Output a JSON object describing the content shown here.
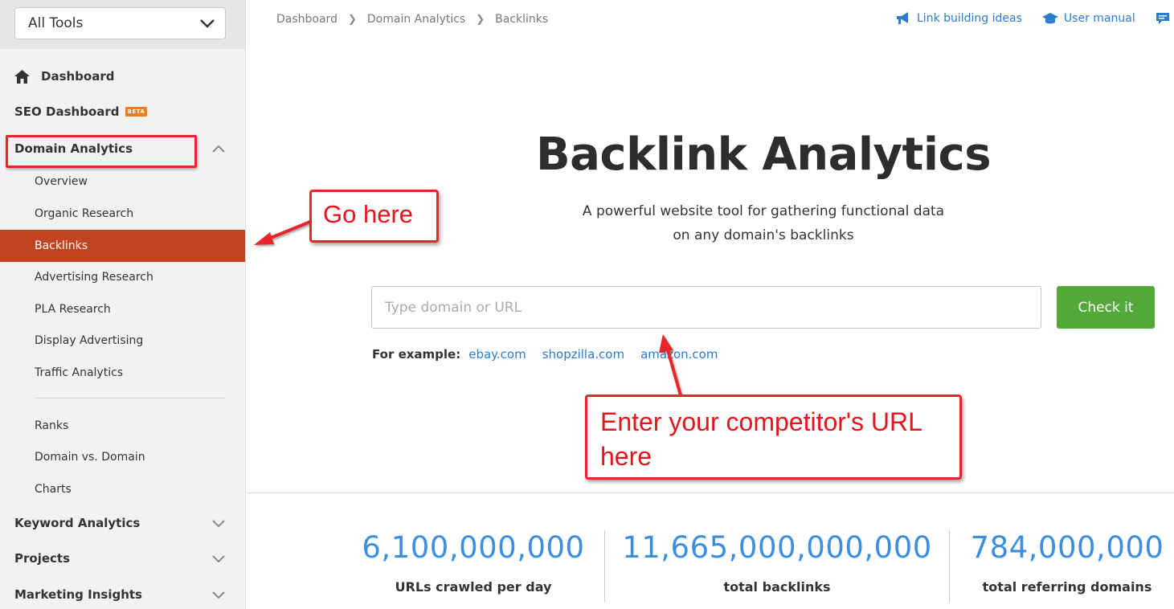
{
  "sidebar": {
    "tools_select": "All Tools",
    "dashboard": "Dashboard",
    "seo_dashboard": "SEO Dashboard",
    "beta_badge": "BETA",
    "domain_analytics": "Domain Analytics",
    "sub_items": [
      "Overview",
      "Organic Research",
      "Backlinks",
      "Advertising Research",
      "PLA Research",
      "Display Advertising",
      "Traffic Analytics",
      "Ranks",
      "Domain vs. Domain",
      "Charts"
    ],
    "keyword_analytics": "Keyword Analytics",
    "projects": "Projects",
    "marketing_insights": "Marketing Insights"
  },
  "breadcrumb": [
    "Dashboard",
    "Domain Analytics",
    "Backlinks"
  ],
  "header_links": {
    "link_building": "Link building ideas",
    "user_manual": "User manual",
    "truncated": "S"
  },
  "main": {
    "title": "Backlink Analytics",
    "subtitle_line1": "A powerful website tool for gathering functional data",
    "subtitle_line2": "on any domain's backlinks",
    "search_placeholder": "Type domain or URL",
    "check_button": "Check it",
    "examples_label": "For example:",
    "examples": [
      "ebay.com",
      "shopzilla.com",
      "amazon.com"
    ]
  },
  "stats": [
    {
      "value": "6,100,000,000",
      "label": "URLs crawled per day"
    },
    {
      "value": "11,665,000,000,000",
      "label": "total backlinks"
    },
    {
      "value": "784,000,000",
      "label": "total referring domains"
    }
  ],
  "annotations": {
    "go_here": "Go here",
    "enter_url_line1": "Enter your competitor's URL",
    "enter_url_line2": "here"
  },
  "colors": {
    "active_nav": "#c14421",
    "check_button": "#52a838",
    "link": "#2b7bd1",
    "stat_number": "#3d8ee0",
    "annotation_red": "#e6262a",
    "beta": "#f07d1a"
  }
}
